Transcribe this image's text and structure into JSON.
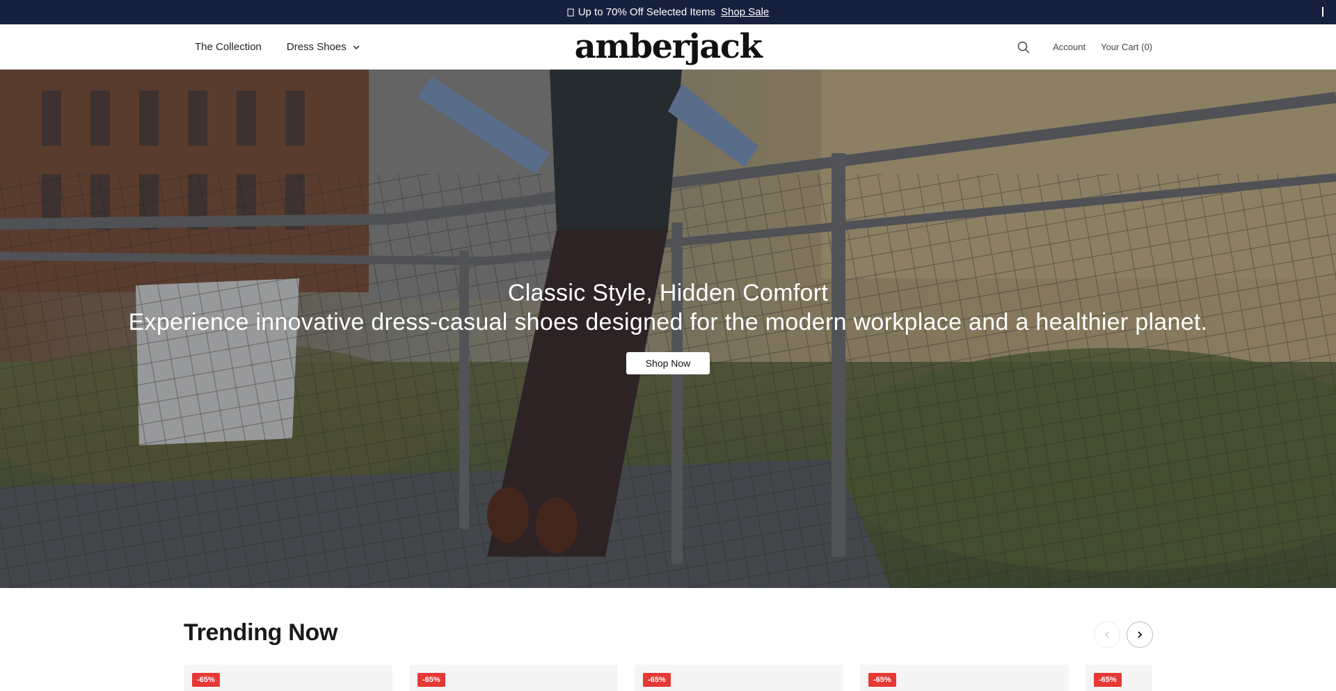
{
  "announcement": {
    "text": "Up to 70% Off Selected Items",
    "link_label": "Shop Sale"
  },
  "header": {
    "logo": "amberjack",
    "nav": [
      {
        "label": "The Collection"
      },
      {
        "label": "Dress Shoes"
      }
    ],
    "account_label": "Account",
    "cart_label": "Your Cart (0)"
  },
  "hero": {
    "title": "Classic Style, Hidden Comfort",
    "subtitle": "Experience innovative dress-casual shoes designed for the modern workplace and a healthier planet.",
    "cta_label": "Shop Now"
  },
  "trending": {
    "title": "Trending Now",
    "products": [
      {
        "badge": "-65%"
      },
      {
        "badge": "-65%"
      },
      {
        "badge": "-65%"
      },
      {
        "badge": "-65%"
      },
      {
        "badge": "-65%"
      }
    ]
  },
  "colors": {
    "announcement_bg": "#17213f",
    "sale_badge": "#e53935"
  }
}
